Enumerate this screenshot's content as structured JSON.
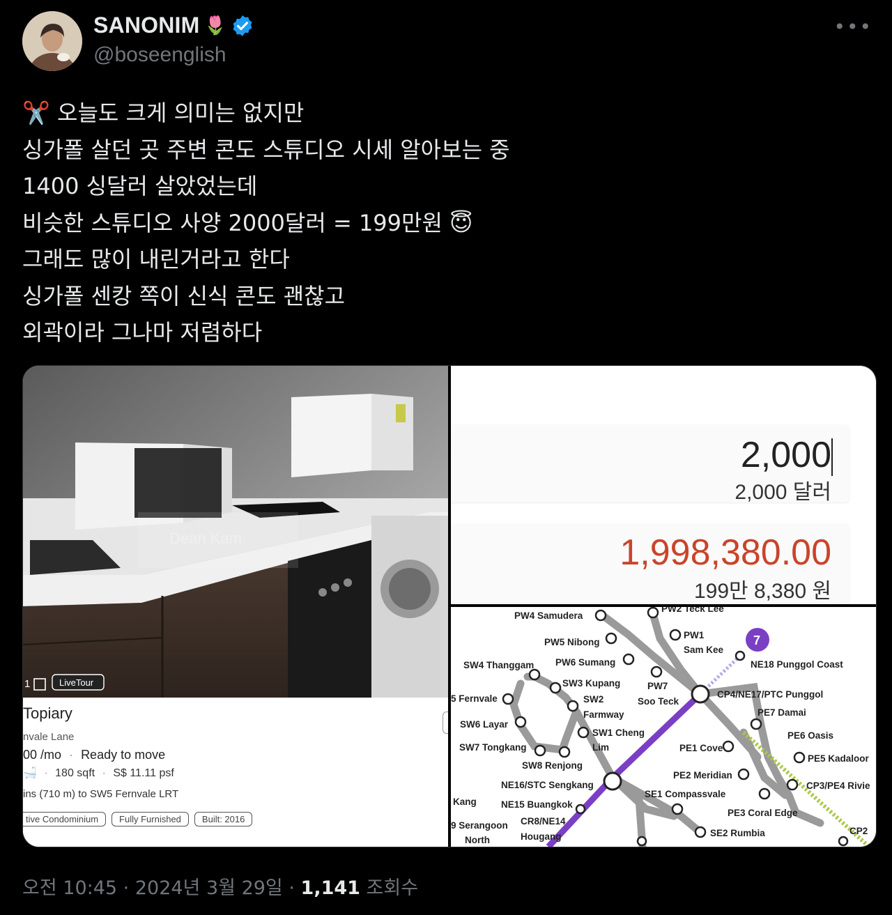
{
  "author": {
    "display_name": "SANONIM",
    "name_emoji": "🌷",
    "handle": "@boseenglish",
    "verified": true,
    "verified_color": "#1d9bf0"
  },
  "more_icon": "more-horizontal-icon",
  "tweet_lines": [
    "✂️ 오늘도 크게 의미는 없지만",
    "싱가폴 살던 곳 주변 콘도 스튜디오 시세 알아보는 중",
    "1400 싱달러 살았었는데",
    "비슷한 스튜디오 사양 2000달러 = 199만원 😇",
    "그래도 많이 내린거라고 한다",
    "싱가폴 센캉 쪽이 신식 콘도 괜찮고",
    "외곽이라 그나마 저렴하다"
  ],
  "media": {
    "kitchen": {
      "watermark": "Dean Kam",
      "badge_count": "1",
      "live_tour": "LiveTour",
      "title": "Topiary",
      "street": "nvale Lane",
      "price": "00 /mo",
      "status": "Ready to move",
      "size": "180 sqft",
      "psf": "S$ 11.11 psf",
      "mrt": "ins (710 m) to SW5 Fernvale LRT",
      "tags": [
        "tive Condominium",
        "Fully Furnished",
        "Built: 2016"
      ]
    },
    "calculator": {
      "input_value": "2,000",
      "input_sub": "2,000 달러",
      "result_value": "1,998,380.00",
      "result_sub": "199만 8,380 원",
      "result_color": "#c9442a"
    },
    "map": {
      "line_badge": "7",
      "line_color": "#7b3fc4",
      "lrt_color": "#9a9a9a",
      "accent_color": "#a8c94a",
      "stations": [
        "PW4 Samudera",
        "PW2 Teck Lee",
        "PW1",
        "Sam Kee",
        "PW5 Nibong",
        "NE18 Punggol Coast",
        "SW4 Thanggam",
        "PW6 Sumang",
        "SW3 Kupang",
        "PW7",
        "Soo Teck",
        "CP4/NE17/PTC Punggol",
        "5 Fernvale",
        "SW2",
        "Farmway",
        "PE7 Damai",
        "SW6 Layar",
        "SW1 Cheng",
        "Lim",
        "PE6 Oasis",
        "SW7 Tongkang",
        "PE1 Cove",
        "PE5 Kadaloor",
        "SW8 Renjong",
        "PE2 Meridian",
        "NE16/STC Sengkang",
        "PE4 Rivie",
        "CP3/PE4 Rivie",
        "SE1 Compassvale",
        "Kang",
        "NE15 Buangkok",
        "PE3 Coral Edge",
        "9 Serangoon",
        "CR8/NE14",
        "North",
        "Hougang",
        "SE2 Rumbia",
        "CP2"
      ]
    }
  },
  "meta": {
    "time": "오전 10:45",
    "date": "2024년 3월 29일",
    "views_count": "1,141",
    "views_label": "조회수"
  }
}
